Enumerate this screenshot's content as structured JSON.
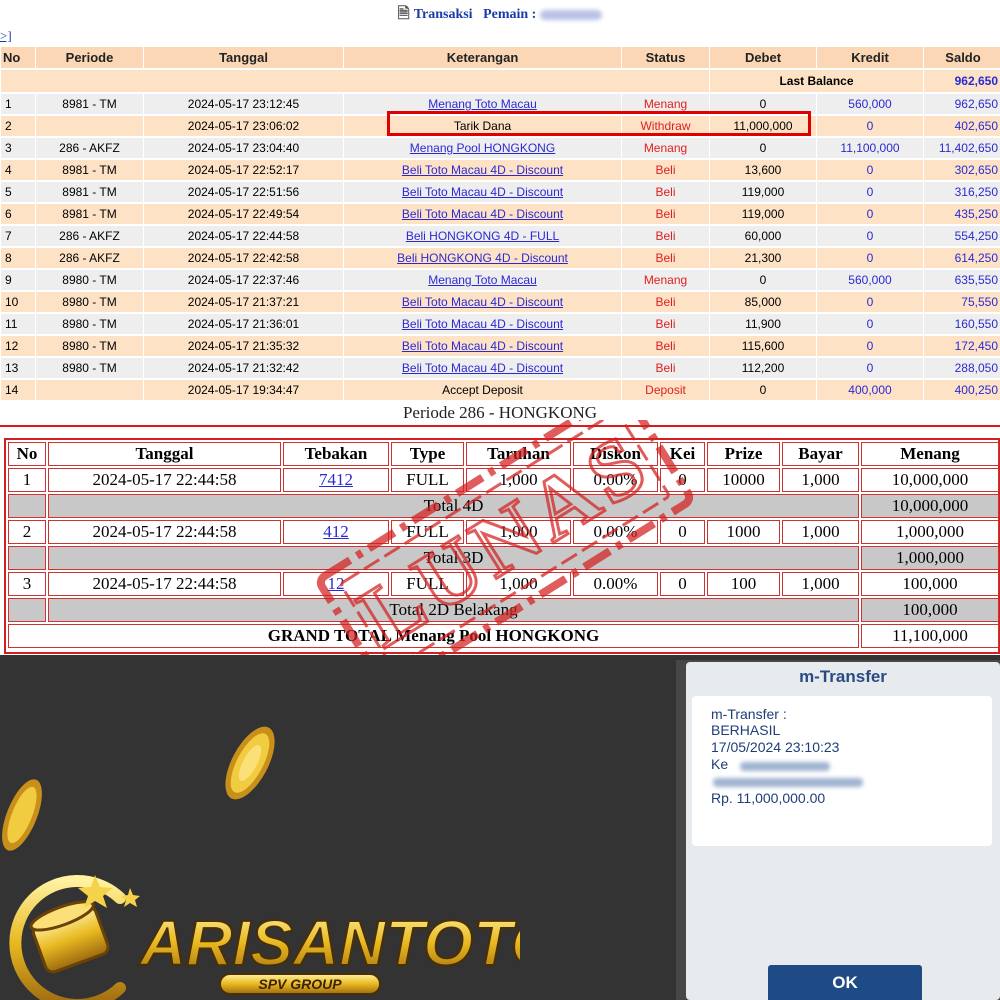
{
  "header": {
    "title_label": "Transaksi",
    "player_label": "Pemain :",
    "back_link": ">]"
  },
  "transactions": {
    "columns": [
      "No",
      "Periode",
      "Tanggal",
      "Keterangan",
      "Status",
      "Debet",
      "Kredit",
      "Saldo"
    ],
    "last_balance_label": "Last Balance",
    "last_balance_value": "962,650",
    "rows": [
      {
        "no": "1",
        "periode": "8981 - TM",
        "tanggal": "2024-05-17 23:12:45",
        "keterangan": "Menang Toto Macau",
        "status": "Menang",
        "debet": "0",
        "kredit": "560,000",
        "saldo": "962,650"
      },
      {
        "no": "2",
        "periode": "",
        "tanggal": "2024-05-17 23:06:02",
        "keterangan": "Tarik Dana",
        "status": "Withdraw",
        "debet": "11,000,000",
        "kredit": "0",
        "saldo": "402,650"
      },
      {
        "no": "3",
        "periode": "286 - AKFZ",
        "tanggal": "2024-05-17 23:04:40",
        "keterangan": "Menang Pool HONGKONG",
        "status": "Menang",
        "debet": "0",
        "kredit": "11,100,000",
        "saldo": "11,402,650"
      },
      {
        "no": "4",
        "periode": "8981 - TM",
        "tanggal": "2024-05-17 22:52:17",
        "keterangan": "Beli Toto Macau 4D - Discount",
        "status": "Beli",
        "debet": "13,600",
        "kredit": "0",
        "saldo": "302,650"
      },
      {
        "no": "5",
        "periode": "8981 - TM",
        "tanggal": "2024-05-17 22:51:56",
        "keterangan": "Beli Toto Macau 4D - Discount",
        "status": "Beli",
        "debet": "119,000",
        "kredit": "0",
        "saldo": "316,250"
      },
      {
        "no": "6",
        "periode": "8981 - TM",
        "tanggal": "2024-05-17 22:49:54",
        "keterangan": "Beli Toto Macau 4D - Discount",
        "status": "Beli",
        "debet": "119,000",
        "kredit": "0",
        "saldo": "435,250"
      },
      {
        "no": "7",
        "periode": "286 - AKFZ",
        "tanggal": "2024-05-17 22:44:58",
        "keterangan": "Beli HONGKONG 4D - FULL",
        "status": "Beli",
        "debet": "60,000",
        "kredit": "0",
        "saldo": "554,250"
      },
      {
        "no": "8",
        "periode": "286 - AKFZ",
        "tanggal": "2024-05-17 22:42:58",
        "keterangan": "Beli HONGKONG 4D - Discount",
        "status": "Beli",
        "debet": "21,300",
        "kredit": "0",
        "saldo": "614,250"
      },
      {
        "no": "9",
        "periode": "8980 - TM",
        "tanggal": "2024-05-17 22:37:46",
        "keterangan": "Menang Toto Macau",
        "status": "Menang",
        "debet": "0",
        "kredit": "560,000",
        "saldo": "635,550"
      },
      {
        "no": "10",
        "periode": "8980 - TM",
        "tanggal": "2024-05-17 21:37:21",
        "keterangan": "Beli Toto Macau 4D - Discount",
        "status": "Beli",
        "debet": "85,000",
        "kredit": "0",
        "saldo": "75,550"
      },
      {
        "no": "11",
        "periode": "8980 - TM",
        "tanggal": "2024-05-17 21:36:01",
        "keterangan": "Beli Toto Macau 4D - Discount",
        "status": "Beli",
        "debet": "11,900",
        "kredit": "0",
        "saldo": "160,550"
      },
      {
        "no": "12",
        "periode": "8980 - TM",
        "tanggal": "2024-05-17 21:35:32",
        "keterangan": "Beli Toto Macau 4D - Discount",
        "status": "Beli",
        "debet": "115,600",
        "kredit": "0",
        "saldo": "172,450"
      },
      {
        "no": "13",
        "periode": "8980 - TM",
        "tanggal": "2024-05-17 21:32:42",
        "keterangan": "Beli Toto Macau 4D - Discount",
        "status": "Beli",
        "debet": "112,200",
        "kredit": "0",
        "saldo": "288,050"
      },
      {
        "no": "14",
        "periode": "",
        "tanggal": "2024-05-17 19:34:47",
        "keterangan": "Accept Deposit",
        "status": "Deposit",
        "debet": "0",
        "kredit": "400,000",
        "saldo": "400,250"
      }
    ]
  },
  "periode": {
    "title": "Periode 286 - HONGKONG",
    "columns": [
      "No",
      "Tanggal",
      "Tebakan",
      "Type",
      "Taruhan",
      "Diskon",
      "Kei",
      "Prize",
      "Bayar",
      "Menang"
    ],
    "rows": [
      {
        "no": "1",
        "tanggal": "2024-05-17 22:44:58",
        "tebakan": "7412",
        "type": "FULL",
        "taruhan": "1,000",
        "diskon": "0.00%",
        "kei": "0",
        "prize": "10000",
        "bayar": "1,000",
        "menang": "10,000,000"
      },
      {
        "no": "2",
        "tanggal": "2024-05-17 22:44:58",
        "tebakan": "412",
        "type": "FULL",
        "taruhan": "1,000",
        "diskon": "0.00%",
        "kei": "0",
        "prize": "1000",
        "bayar": "1,000",
        "menang": "1,000,000"
      },
      {
        "no": "3",
        "tanggal": "2024-05-17 22:44:58",
        "tebakan": "12",
        "type": "FULL",
        "taruhan": "1,000",
        "diskon": "0.00%",
        "kei": "0",
        "prize": "100",
        "bayar": "1,000",
        "menang": "100,000"
      }
    ],
    "totals": [
      {
        "label": "Total 4D",
        "value": "10,000,000"
      },
      {
        "label": "Total 3D",
        "value": "1,000,000"
      },
      {
        "label": "Total 2D Belakang",
        "value": "100,000"
      }
    ],
    "grand_total_label": "GRAND TOTAL  Menang Pool HONGKONG",
    "grand_total_value": "11,100,000"
  },
  "stamp": {
    "text": "LUNAS"
  },
  "transfer": {
    "header": "m-Transfer",
    "line1": "m-Transfer :",
    "line2": "BERHASIL",
    "line3": "17/05/2024 23:10:23",
    "line4": "Ke",
    "amount": "Rp. 11,000,000.00",
    "ok_label": "OK"
  },
  "brand": {
    "name": "ARISANTOTO",
    "tagline": "SPV GROUP",
    "gold": "#e8b820",
    "dark_bg": "#333333"
  },
  "colors": {
    "header_bg": "#fbd7b5",
    "row_odd": "#eeeeee",
    "row_even": "#fde2c6",
    "link": "#2a2ad4",
    "status_red": "#e02020",
    "highlight": "#e00000"
  }
}
